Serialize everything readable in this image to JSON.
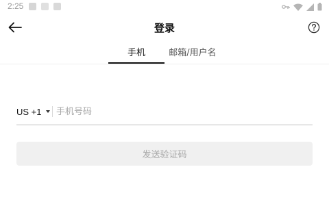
{
  "status_bar": {
    "time": "2:25",
    "icons": [
      "notification-icon",
      "notification-icon",
      "notification-icon",
      "vpn-key-icon",
      "wifi-icon",
      "signal-icon",
      "battery-icon"
    ]
  },
  "header": {
    "title": "登录",
    "back_icon": "arrow-left-icon",
    "help_icon": "help-circle-icon"
  },
  "tabs": [
    {
      "label": "手机",
      "active": true
    },
    {
      "label": "邮箱/用户名",
      "active": false
    }
  ],
  "phone_form": {
    "country_code": "US +1",
    "phone_value": "",
    "phone_placeholder": "手机号码",
    "send_code_label": "发送验证码"
  },
  "colors": {
    "tab_indicator": "#111111",
    "button_disabled_bg": "#f0f0f0",
    "button_disabled_text": "#a9a9a9",
    "placeholder": "#a8a8a8"
  }
}
